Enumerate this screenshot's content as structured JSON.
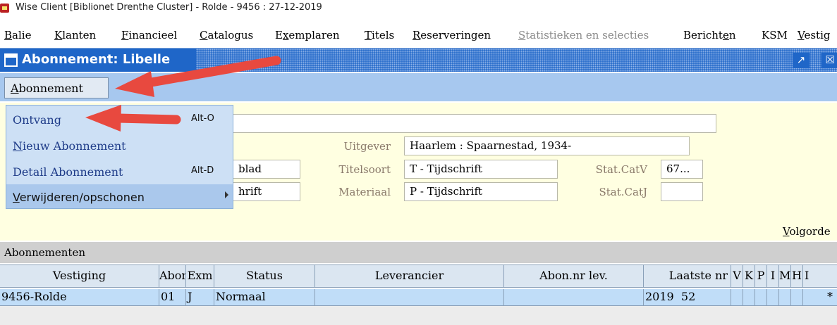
{
  "window": {
    "title": "Wise Client [Biblionet Drenthe Cluster] - Rolde - 9456 : 27-12-2019"
  },
  "menubar": {
    "items": [
      {
        "pre": "",
        "ul": "B",
        "post": "alie",
        "disabled": false
      },
      {
        "pre": "",
        "ul": "K",
        "post": "lanten",
        "disabled": false
      },
      {
        "pre": "",
        "ul": "F",
        "post": "inancieel",
        "disabled": false
      },
      {
        "pre": "",
        "ul": "C",
        "post": "atalogus",
        "disabled": false
      },
      {
        "pre": "E",
        "ul": "x",
        "post": "emplaren",
        "disabled": false
      },
      {
        "pre": "",
        "ul": "T",
        "post": "itels",
        "disabled": false
      },
      {
        "pre": "",
        "ul": "R",
        "post": "eserveringen",
        "disabled": false
      },
      {
        "pre": "",
        "ul": "S",
        "post": "tatistieken en selecties",
        "disabled": true
      },
      {
        "pre": "Bericht",
        "ul": "e",
        "post": "n",
        "disabled": false
      },
      {
        "pre": "KSM",
        "ul": "",
        "post": "",
        "disabled": false
      },
      {
        "pre": "",
        "ul": "V",
        "post": "estig",
        "disabled": false
      }
    ]
  },
  "caption": {
    "title": "Abonnement: Libelle",
    "restore_glyph": "↗",
    "close_glyph": "☒"
  },
  "localmenu": {
    "label_ul": "A",
    "label_rest": "bonnement"
  },
  "dropdown": {
    "items": [
      {
        "ul": "",
        "rest": "Ontvang",
        "accel": "Alt-O",
        "style": "serif"
      },
      {
        "ul": "N",
        "rest": "ieuw Abonnement",
        "accel": "",
        "style": "serif"
      },
      {
        "ul": "",
        "rest": "Detail Abonnement",
        "accel": "Alt-D",
        "style": "serif"
      },
      {
        "ul": "V",
        "rest": "erwijderen/opschonen",
        "accel": "",
        "style": "sans",
        "submenu": true
      }
    ]
  },
  "form": {
    "fields": {
      "blad_fragment": "blad",
      "hrift_fragment": "hrift",
      "uitgever_label": "Uitgever",
      "uitgever_value": "Haarlem : Spaarnestad, 1934-",
      "titelsoort_label": "Titelsoort",
      "titelsoort_value": "T - Tijdschrift",
      "materiaal_label": "Materiaal",
      "materiaal_value": "P - Tijdschrift",
      "statcatv_label": "Stat.CatV",
      "statcatv_value": "67...",
      "statcatj_label": "Stat.CatJ",
      "statcatj_value": ""
    },
    "volgorde_ul": "V",
    "volgorde_rest": "olgorde"
  },
  "section": {
    "title": "Abonnementen"
  },
  "grid": {
    "columns": [
      "Vestiging",
      "Abon",
      "Exm",
      "Status",
      "Leverancier",
      "Abon.nr lev.",
      "Laatste nr",
      "V",
      "K",
      "P",
      "I",
      "M",
      "H",
      "I"
    ],
    "rows": [
      [
        "9456-Rolde",
        "01",
        "J",
        "Normaal",
        "",
        "",
        "2019  52",
        "",
        "",
        "",
        "",
        "",
        "",
        "*"
      ]
    ]
  },
  "colors": {
    "caption_blue": "#1f66c8",
    "local_menu_blue": "#a7c8ef",
    "form_background": "#ffffe1",
    "annotation_arrow": "#e8493f"
  }
}
